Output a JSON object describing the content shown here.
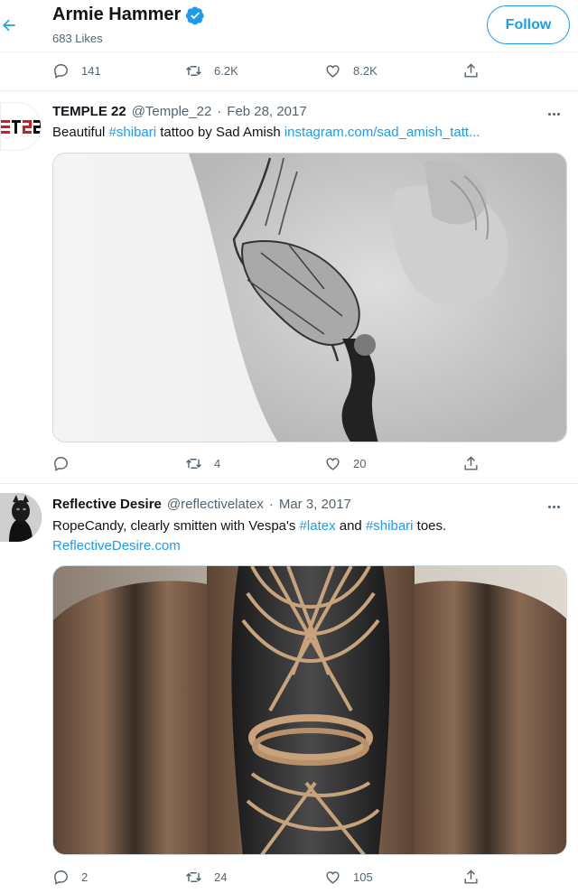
{
  "header": {
    "name": "Armie Hammer",
    "likes": "683 Likes",
    "follow_label": "Follow"
  },
  "top_actions": {
    "replies": "141",
    "retweets": "6.2K",
    "likes": "8.2K"
  },
  "tweets": [
    {
      "name": "TEMPLE 22",
      "handle": "@Temple_22",
      "sep": "·",
      "date": "Feb 28, 2017",
      "text_parts": [
        "Beautiful ",
        "#shibari",
        " tattoo by Sad Amish ",
        "instagram.com/sad_amish_tatt..."
      ],
      "avatar_text": "ƎTƧ",
      "replies": "",
      "retweets": "4",
      "likes": "20"
    },
    {
      "name": "Reflective Desire",
      "handle": "@reflectivelatex",
      "sep": "·",
      "date": "Mar 3, 2017",
      "text_parts": [
        "RopeCandy, clearly smitten with Vespa's ",
        "#latex",
        " and ",
        "#shibari",
        " toes."
      ],
      "link_line": "ReflectiveDesire.com",
      "replies": "2",
      "retweets": "24",
      "likes": "105"
    }
  ],
  "colors": {
    "accent": "#1d9bf0",
    "muted": "#536471",
    "text": "#0f1419",
    "border": "#e6ecf0"
  },
  "icons": [
    "back-arrow-icon",
    "verified-badge-icon",
    "reply-icon",
    "retweet-icon",
    "like-icon",
    "share-icon",
    "more-icon"
  ]
}
